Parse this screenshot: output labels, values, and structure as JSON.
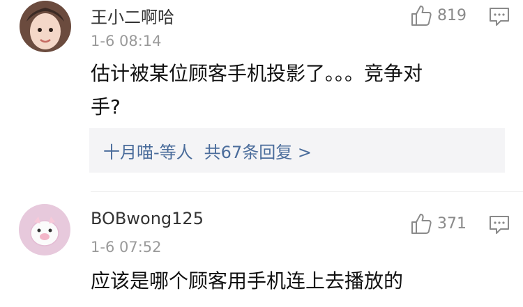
{
  "comments": [
    {
      "username": "王小二啊哈",
      "time": "1-6 08:14",
      "likes": "819",
      "content_line1": "估计被某位顾客手机投影了。。。竞争对",
      "content_line2": "手?",
      "reply_preview_author": "十月喵-等人",
      "reply_preview_count": "共67条回复 >"
    },
    {
      "username": "BOBwong125",
      "time": "1-6 07:52",
      "likes": "371",
      "content_line1": "应该是哪个顾客用手机连上去播放的"
    }
  ],
  "colors": {
    "link": "#4a6c9b",
    "reply_bg": "#f4f4f6",
    "meta": "#9a9a9a"
  },
  "icons": [
    "thumbs-up-icon",
    "reply-comment-icon"
  ]
}
